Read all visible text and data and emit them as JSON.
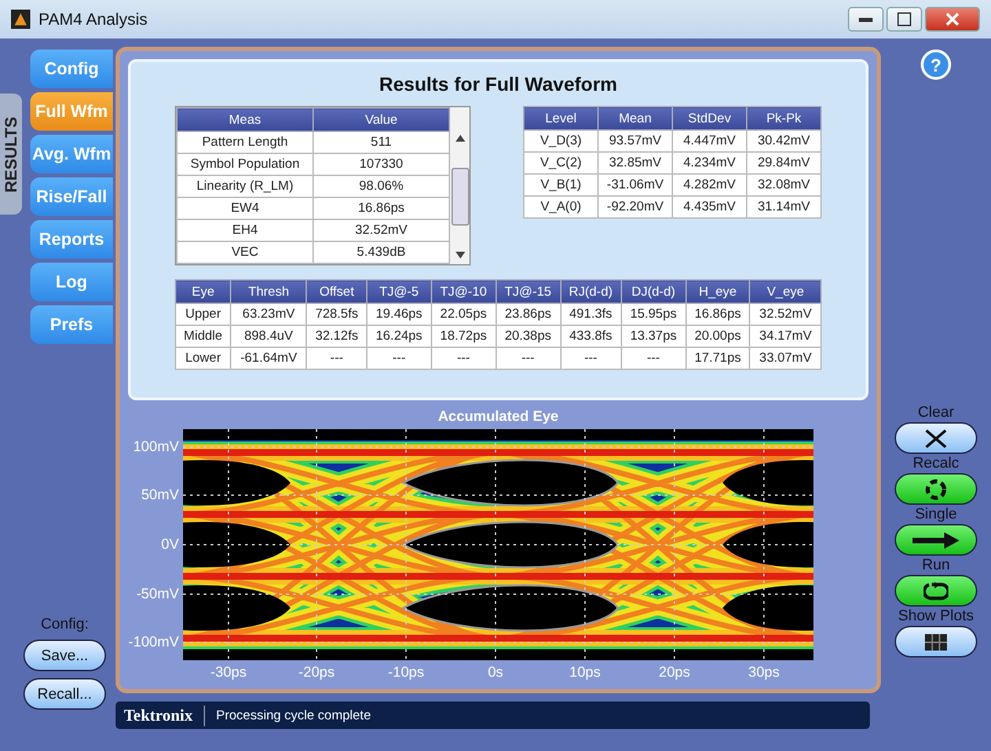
{
  "window": {
    "title": "PAM4 Analysis"
  },
  "side_label": "RESULTS",
  "tabs": [
    {
      "label": "Config",
      "selected": false
    },
    {
      "label": "Full Wfm",
      "selected": true
    },
    {
      "label": "Avg. Wfm",
      "selected": false
    },
    {
      "label": "Rise/Fall",
      "selected": false
    },
    {
      "label": "Reports",
      "selected": false
    },
    {
      "label": "Log",
      "selected": false
    },
    {
      "label": "Prefs",
      "selected": false
    }
  ],
  "config": {
    "label": "Config:",
    "buttons": [
      "Save...",
      "Recall..."
    ]
  },
  "results": {
    "title": "Results for Full Waveform",
    "meas_table": {
      "columns": [
        "Meas",
        "Value"
      ],
      "rows": [
        [
          "Pattern Length",
          "511"
        ],
        [
          "Symbol Population",
          "107330"
        ],
        [
          "Linearity (R_LM)",
          "98.06%"
        ],
        [
          "EW4",
          "16.86ps"
        ],
        [
          "EH4",
          "32.52mV"
        ],
        [
          "VEC",
          "5.439dB"
        ]
      ]
    },
    "level_table": {
      "columns": [
        "Level",
        "Mean",
        "StdDev",
        "Pk-Pk"
      ],
      "rows": [
        [
          "V_D(3)",
          "93.57mV",
          "4.447mV",
          "30.42mV"
        ],
        [
          "V_C(2)",
          "32.85mV",
          "4.234mV",
          "29.84mV"
        ],
        [
          "V_B(1)",
          "-31.06mV",
          "4.282mV",
          "32.08mV"
        ],
        [
          "V_A(0)",
          "-92.20mV",
          "4.435mV",
          "31.14mV"
        ]
      ]
    },
    "eye_table": {
      "columns": [
        "Eye",
        "Thresh",
        "Offset",
        "TJ@-5",
        "TJ@-10",
        "TJ@-15",
        "RJ(d-d)",
        "DJ(d-d)",
        "H_eye",
        "V_eye"
      ],
      "rows": [
        [
          "Upper",
          "63.23mV",
          "728.5fs",
          "19.46ps",
          "22.05ps",
          "23.86ps",
          "491.3fs",
          "15.95ps",
          "16.86ps",
          "32.52mV"
        ],
        [
          "Middle",
          "898.4uV",
          "32.12fs",
          "16.24ps",
          "18.72ps",
          "20.38ps",
          "433.8fs",
          "13.37ps",
          "20.00ps",
          "34.17mV"
        ],
        [
          "Lower",
          "-61.64mV",
          "---",
          "---",
          "---",
          "---",
          "---",
          "---",
          "17.71ps",
          "33.07mV"
        ]
      ]
    }
  },
  "eye_plot": {
    "title": "Accumulated Eye",
    "y_labels": [
      "100mV",
      "50mV",
      "0V",
      "-50mV",
      "-100mV"
    ],
    "x_labels": [
      "-30ps",
      "-20ps",
      "-10ps",
      "0s",
      "10ps",
      "20ps",
      "30ps"
    ]
  },
  "status_bar": {
    "brand": "Tektronix",
    "message": "Processing cycle complete"
  },
  "help": "?",
  "controls": [
    {
      "label": "Clear",
      "kind": "clear"
    },
    {
      "label": "Recalc",
      "kind": "recalc"
    },
    {
      "label": "Single",
      "kind": "single"
    },
    {
      "label": "Run",
      "kind": "run"
    },
    {
      "label": "Show Plots",
      "kind": "plots"
    }
  ]
}
